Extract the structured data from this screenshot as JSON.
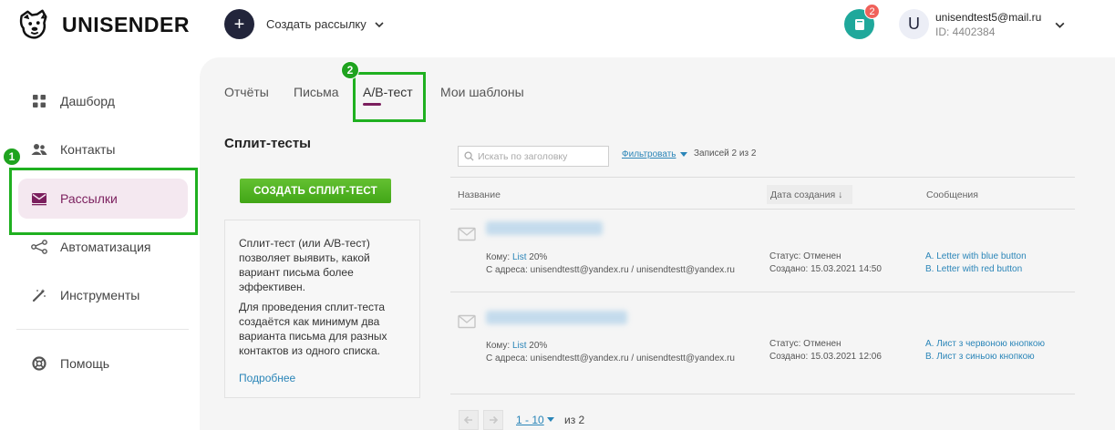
{
  "header": {
    "logo_text": "UNISENDER",
    "create_button_glyph": "+",
    "create_label": "Создать рассылку",
    "notifications_count": "2",
    "avatar_letter": "U",
    "user_email": "unisendtest5@mail.ru",
    "user_id": "ID: 4402384"
  },
  "sidebar": {
    "items": [
      {
        "label": "Дашборд",
        "icon": "dashboard-icon"
      },
      {
        "label": "Контакты",
        "icon": "contacts-icon"
      },
      {
        "label": "Рассылки",
        "icon": "mail-icon",
        "active": true
      },
      {
        "label": "Автоматизация",
        "icon": "automation-icon"
      },
      {
        "label": "Инструменты",
        "icon": "magic-wand-icon"
      },
      {
        "label": "Помощь",
        "icon": "help-lifebuoy-icon"
      }
    ],
    "step_badge": "1"
  },
  "tabs": {
    "items": [
      "Отчёты",
      "Письма",
      "А/В-тест",
      "Мои шаблоны"
    ],
    "active_index": 2,
    "step_badge": "2"
  },
  "main": {
    "section_title": "Сплит-тесты",
    "create_button": "СОЗДАТЬ СПЛИТ-ТЕСТ",
    "info": {
      "p1": "Сплит-тест (или А/В-тест) позволяет выявить, какой вариант письма более эффективен.",
      "p2": "Для проведения сплит-теста создаётся как минимум два варианта письма для разных контактов из одного списка.",
      "link": "Подробнее"
    },
    "search_placeholder": "Искать по заголовку",
    "filter_label": "Фильтровать",
    "records_label": "Записей 2 из 2",
    "columns": {
      "name": "Название",
      "date": "Дата создания ↓",
      "messages": "Сообщения"
    },
    "rows": [
      {
        "to_prefix": "Кому:",
        "to_list": "List",
        "to_pct": "20%",
        "from": "С адреса: unisendtestt@yandex.ru / unisendtestt@yandex.ru",
        "status": "Статус: Отменен",
        "created": "Создано: 15.03.2021 14:50",
        "msg_a": "A. Letter with blue button",
        "msg_b": "B. Letter with red button"
      },
      {
        "to_prefix": "Кому:",
        "to_list": "List",
        "to_pct": "20%",
        "from": "С адреса: unisendtestt@yandex.ru / unisendtestt@yandex.ru",
        "status": "Статус: Отменен",
        "created": "Создано: 15.03.2021 12:06",
        "msg_a": "A. Лист з червоною кнопкою",
        "msg_b": "B. Лист з синьою кнопкою"
      }
    ],
    "pagination": {
      "range": "1 - 10",
      "of": "из 2"
    }
  },
  "colors": {
    "brand_purple": "#7b1f5e",
    "highlight_green": "#1fb020",
    "button_green": "#4fb11f",
    "link_blue": "#2a85b8",
    "notif_teal": "#1fa89b",
    "badge_red": "#f0615a"
  }
}
